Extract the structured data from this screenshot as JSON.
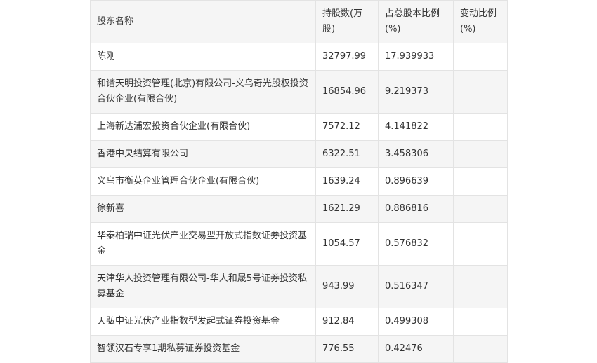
{
  "table": {
    "headers": [
      "股东名称",
      "持股数(万股)",
      "占总股本比例(%)",
      "变动比例(%)"
    ],
    "rows": [
      {
        "name": "陈刚",
        "shares": "32797.99",
        "ratio": "17.939933",
        "change": ""
      },
      {
        "name": "和谐天明投资管理(北京)有限公司-义乌奇光股权投资合伙企业(有限合伙)",
        "shares": "16854.96",
        "ratio": "9.219373",
        "change": ""
      },
      {
        "name": "上海新达浦宏投资合伙企业(有限合伙)",
        "shares": "7572.12",
        "ratio": "4.141822",
        "change": ""
      },
      {
        "name": "香港中央结算有限公司",
        "shares": "6322.51",
        "ratio": "3.458306",
        "change": ""
      },
      {
        "name": "义乌市衡英企业管理合伙企业(有限合伙)",
        "shares": "1639.24",
        "ratio": "0.896639",
        "change": ""
      },
      {
        "name": "徐新喜",
        "shares": "1621.29",
        "ratio": "0.886816",
        "change": ""
      },
      {
        "name": "华泰柏瑞中证光伏产业交易型开放式指数证券投资基金",
        "shares": "1054.57",
        "ratio": "0.576832",
        "change": ""
      },
      {
        "name": "天津华人投资管理有限公司-华人和晟5号证券投资私募基金",
        "shares": "943.99",
        "ratio": "0.516347",
        "change": ""
      },
      {
        "name": "天弘中证光伏产业指数型发起式证券投资基金",
        "shares": "912.84",
        "ratio": "0.499308",
        "change": ""
      },
      {
        "name": "智领汉石专享1期私募证券投资基金",
        "shares": "776.55",
        "ratio": "0.42476",
        "change": ""
      }
    ]
  }
}
